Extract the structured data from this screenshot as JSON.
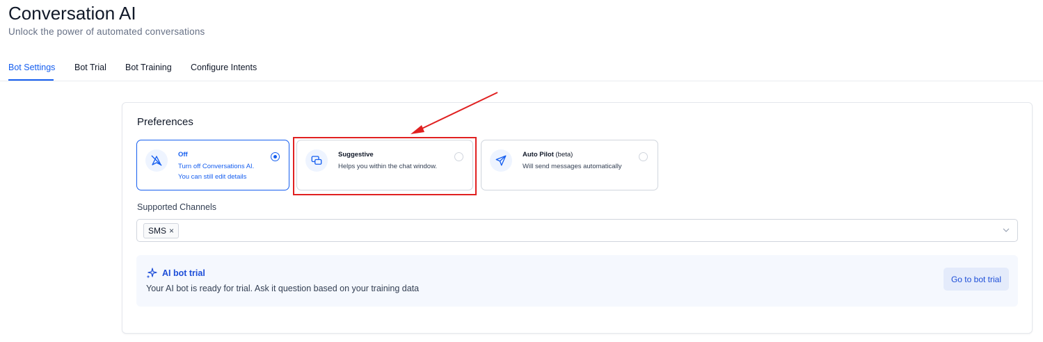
{
  "header": {
    "title": "Conversation AI",
    "subtitle": "Unlock the power of automated conversations"
  },
  "tabs": [
    {
      "label": "Bot Settings",
      "active": true
    },
    {
      "label": "Bot Trial",
      "active": false
    },
    {
      "label": "Bot Training",
      "active": false
    },
    {
      "label": "Configure Intents",
      "active": false
    }
  ],
  "preferences": {
    "heading": "Preferences",
    "options": [
      {
        "title": "Off",
        "title_suffix": "",
        "description": [
          "Turn off Conversations AI.",
          "You can still edit details"
        ],
        "icon": "bot-off-icon",
        "selected": true
      },
      {
        "title": "Suggestive",
        "title_suffix": "",
        "description": [
          "Helps you within the chat window."
        ],
        "icon": "chat-bubbles-icon",
        "selected": false
      },
      {
        "title": "Auto Pilot",
        "title_suffix": "(beta)",
        "description": [
          "Will send messages automatically"
        ],
        "icon": "send-icon",
        "selected": false
      }
    ]
  },
  "channels": {
    "label": "Supported Channels",
    "selected": [
      "SMS"
    ],
    "remove_glyph": "×",
    "dropdown_icon": "chevron-down-icon"
  },
  "trial": {
    "title": "AI bot trial",
    "description": "Your AI bot is ready for trial. Ask it question based on your training data",
    "button": "Go to bot trial",
    "icon": "sparkle-icon"
  },
  "annotation": {
    "color": "#e02020",
    "target": "Suggestive"
  },
  "colors": {
    "accent": "#155eef",
    "border": "#d0d5dd",
    "panel_bg": "#f5f8fe"
  }
}
